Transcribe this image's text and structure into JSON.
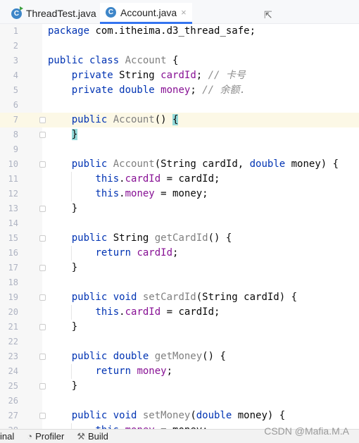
{
  "tabs": [
    {
      "label": "ThreadTest.java",
      "icon": "java-class-runnable-icon",
      "active": false
    },
    {
      "label": "Account.java",
      "icon": "java-class-icon",
      "active": true
    }
  ],
  "tab_icon_letter": "C",
  "close_glyph": "×",
  "editor": {
    "current_line": 7,
    "lines": [
      [
        [
          "package",
          "k"
        ],
        [
          " com.itheima.d3_thread_safe;",
          ""
        ]
      ],
      [],
      [
        [
          "public class",
          "k"
        ],
        [
          " ",
          ""
        ],
        [
          "Account",
          "u"
        ],
        [
          " {",
          ""
        ]
      ],
      [
        [
          "    ",
          ""
        ],
        [
          "private",
          "k"
        ],
        [
          " String ",
          ""
        ],
        [
          "cardId",
          "f"
        ],
        [
          "; ",
          ""
        ],
        [
          "// 卡号",
          "c"
        ]
      ],
      [
        [
          "    ",
          ""
        ],
        [
          "private double",
          "k"
        ],
        [
          " ",
          ""
        ],
        [
          "money",
          "f"
        ],
        [
          "; ",
          ""
        ],
        [
          "// 余额.",
          "c"
        ]
      ],
      [],
      [
        [
          "    ",
          ""
        ],
        [
          "public",
          "k"
        ],
        [
          " ",
          ""
        ],
        [
          "Account",
          "u"
        ],
        [
          "() ",
          ""
        ],
        [
          "{",
          "b"
        ]
      ],
      [
        [
          "    ",
          ""
        ],
        [
          "}",
          "b"
        ]
      ],
      [],
      [
        [
          "    ",
          ""
        ],
        [
          "public",
          "k"
        ],
        [
          " ",
          ""
        ],
        [
          "Account",
          "u"
        ],
        [
          "(String cardId, ",
          ""
        ],
        [
          "double",
          "k"
        ],
        [
          " money) {",
          ""
        ]
      ],
      [
        [
          "        ",
          ""
        ],
        [
          "this",
          "k"
        ],
        [
          ".",
          ""
        ],
        [
          "cardId",
          "f"
        ],
        [
          " = cardId;",
          ""
        ]
      ],
      [
        [
          "        ",
          ""
        ],
        [
          "this",
          "k"
        ],
        [
          ".",
          ""
        ],
        [
          "money",
          "f"
        ],
        [
          " = money;",
          ""
        ]
      ],
      [
        [
          "    }",
          ""
        ]
      ],
      [],
      [
        [
          "    ",
          ""
        ],
        [
          "public",
          "k"
        ],
        [
          " String ",
          ""
        ],
        [
          "getCardId",
          "u"
        ],
        [
          "() {",
          ""
        ]
      ],
      [
        [
          "        ",
          ""
        ],
        [
          "return",
          "k"
        ],
        [
          " ",
          ""
        ],
        [
          "cardId",
          "f"
        ],
        [
          ";",
          ""
        ]
      ],
      [
        [
          "    }",
          ""
        ]
      ],
      [],
      [
        [
          "    ",
          ""
        ],
        [
          "public void",
          "k"
        ],
        [
          " ",
          ""
        ],
        [
          "setCardId",
          "u"
        ],
        [
          "(String cardId) {",
          ""
        ]
      ],
      [
        [
          "        ",
          ""
        ],
        [
          "this",
          "k"
        ],
        [
          ".",
          ""
        ],
        [
          "cardId",
          "f"
        ],
        [
          " = cardId;",
          ""
        ]
      ],
      [
        [
          "    }",
          ""
        ]
      ],
      [],
      [
        [
          "    ",
          ""
        ],
        [
          "public double",
          "k"
        ],
        [
          " ",
          ""
        ],
        [
          "getMoney",
          "u"
        ],
        [
          "() {",
          ""
        ]
      ],
      [
        [
          "        ",
          ""
        ],
        [
          "return",
          "k"
        ],
        [
          " ",
          ""
        ],
        [
          "money",
          "f"
        ],
        [
          ";",
          ""
        ]
      ],
      [
        [
          "    }",
          ""
        ]
      ],
      [],
      [
        [
          "    ",
          ""
        ],
        [
          "public void",
          "k"
        ],
        [
          " ",
          ""
        ],
        [
          "setMoney",
          "u"
        ],
        [
          "(",
          ""
        ],
        [
          "double",
          "k"
        ],
        [
          " money) {",
          ""
        ]
      ],
      [
        [
          "        ",
          ""
        ],
        [
          "this",
          "k"
        ],
        [
          ".",
          ""
        ],
        [
          "money",
          "f"
        ],
        [
          " = money;",
          ""
        ]
      ]
    ]
  },
  "bottom_bar": {
    "items": [
      {
        "label": "inal",
        "icon": ""
      },
      {
        "label": "Profiler",
        "icon": "profiler-icon"
      },
      {
        "label": "Build",
        "icon": "hammer-icon"
      }
    ]
  },
  "watermark": "CSDN @Mafia.M.A"
}
